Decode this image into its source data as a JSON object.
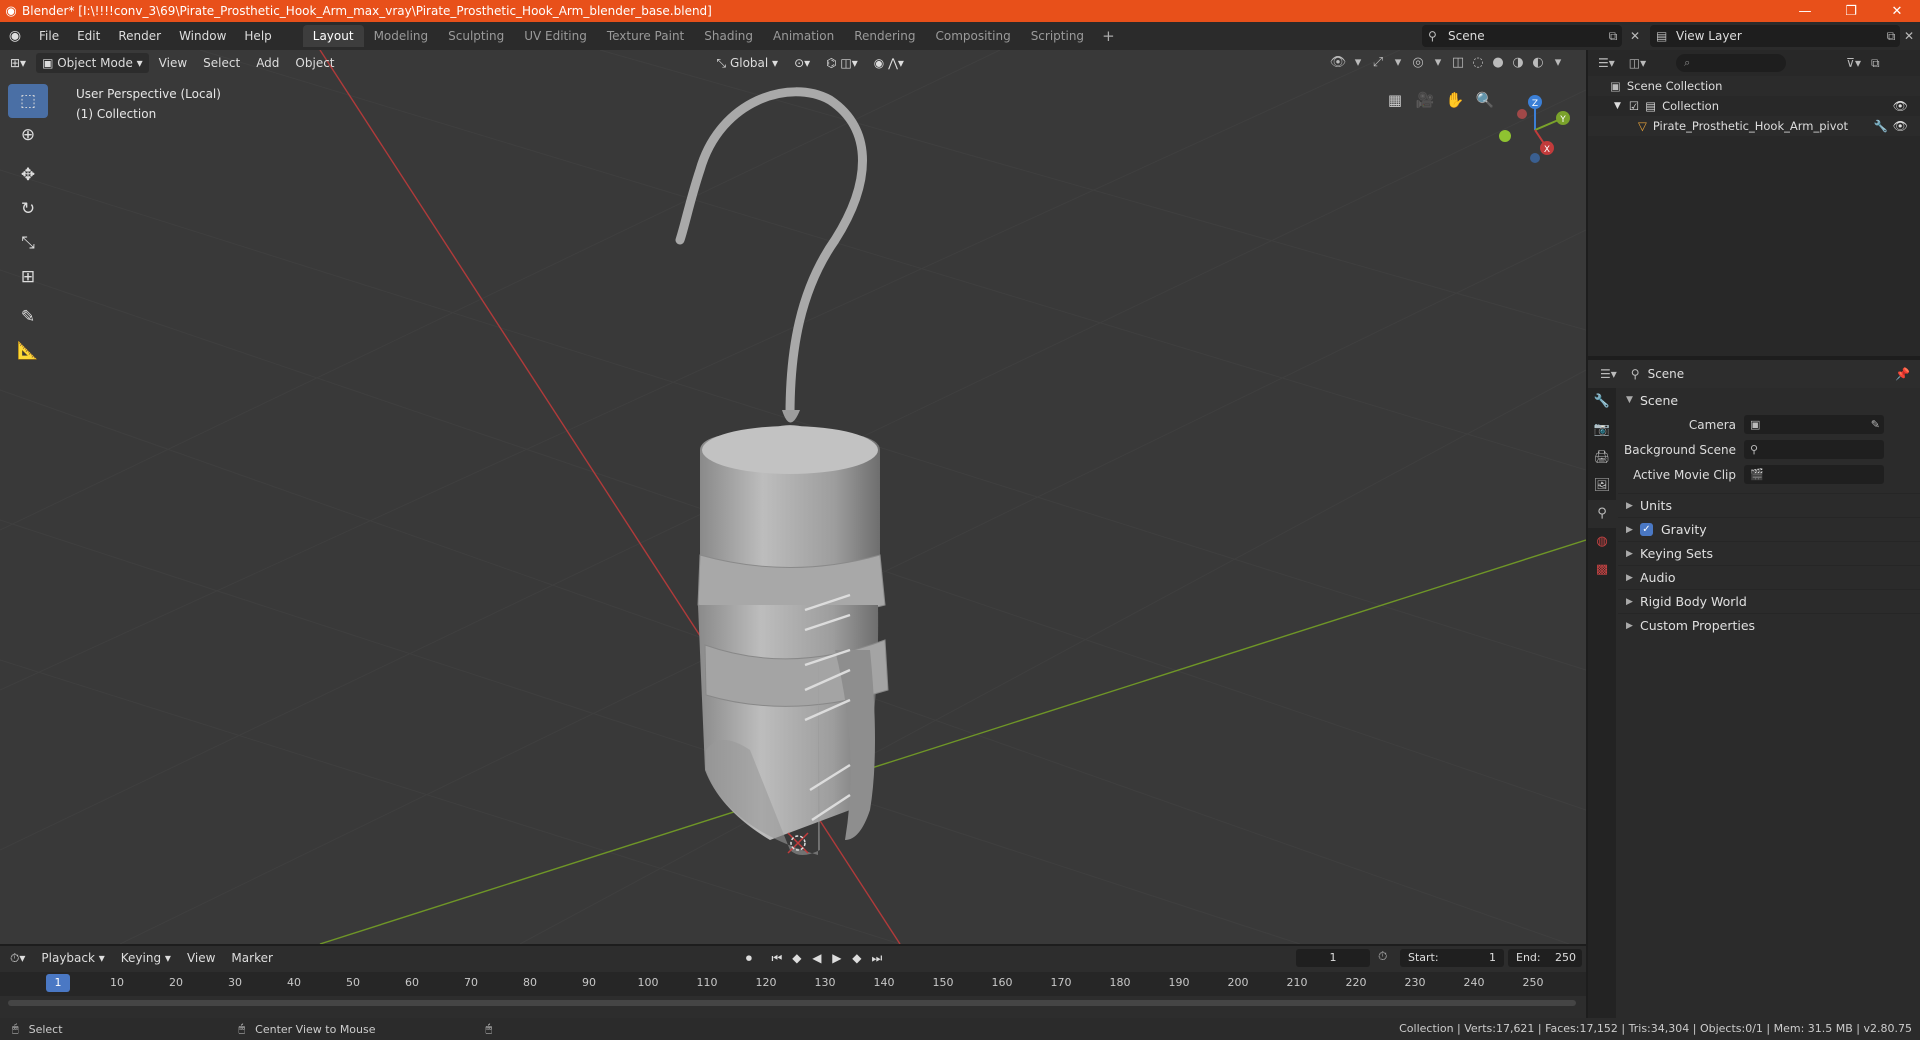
{
  "titlebar": {
    "title": "Blender* [I:\\!!!!conv_3\\69\\Pirate_Prosthetic_Hook_Arm_max_vray\\Pirate_Prosthetic_Hook_Arm_blender_base.blend]",
    "minimize": "—",
    "maximize": "❐",
    "close": "✕"
  },
  "menu": [
    "File",
    "Edit",
    "Render",
    "Window",
    "Help"
  ],
  "workspaces": [
    "Layout",
    "Modeling",
    "Sculpting",
    "UV Editing",
    "Texture Paint",
    "Shading",
    "Animation",
    "Rendering",
    "Compositing",
    "Scripting"
  ],
  "scene_selector": "Scene",
  "view_layer": "View Layer",
  "viewport": {
    "mode": "Object Mode",
    "menus": [
      "View",
      "Select",
      "Add",
      "Object"
    ],
    "orientation": "Global",
    "info_line1": "User Perspective (Local)",
    "info_line2": "(1) Collection"
  },
  "gizmo": {
    "x": "X",
    "y": "Y",
    "z": "Z"
  },
  "outliner": {
    "root": "Scene Collection",
    "collection": "Collection",
    "object": "Pirate_Prosthetic_Hook_Arm_pivot"
  },
  "properties": {
    "header": "Scene",
    "panel": "Scene",
    "rows": [
      {
        "label": "Camera"
      },
      {
        "label": "Background Scene"
      },
      {
        "label": "Active Movie Clip"
      }
    ],
    "subpanels": [
      "Units",
      "Gravity",
      "Keying Sets",
      "Audio",
      "Rigid Body World",
      "Custom Properties"
    ]
  },
  "timeline": {
    "menus": [
      "Playback",
      "Keying",
      "View",
      "Marker"
    ],
    "current_frame": "1",
    "start_label": "Start:",
    "start": "1",
    "end_label": "End:",
    "end": "250",
    "ruler": [
      "1",
      "10",
      "20",
      "30",
      "40",
      "50",
      "60",
      "70",
      "80",
      "90",
      "100",
      "110",
      "120",
      "130",
      "140",
      "150",
      "160",
      "170",
      "180",
      "190",
      "200",
      "210",
      "220",
      "230",
      "240",
      "250"
    ]
  },
  "statusbar": {
    "select": "Select",
    "center_view": "Center View to Mouse",
    "stats": "Collection | Verts:17,621 | Faces:17,152 | Tris:34,304 | Objects:0/1 | Mem: 31.5 MB | v2.80.75"
  },
  "colors": {
    "accent": "#4a78c4",
    "titlebar": "#e8501a",
    "viewport_bg": "#393939",
    "x_axis": "#c23b3b",
    "y_axis": "#7aa22b",
    "z_axis": "#3b7fd6"
  }
}
